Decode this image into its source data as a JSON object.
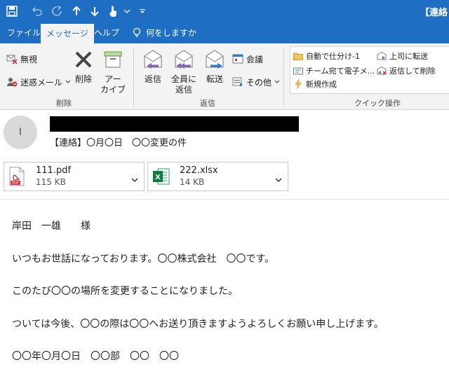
{
  "window": {
    "title": "【連絡"
  },
  "quick_access": [
    {
      "icon": "save-icon"
    },
    {
      "icon": "undo-icon"
    },
    {
      "icon": "redo-icon"
    },
    {
      "icon": "up-arrow-icon"
    },
    {
      "icon": "down-arrow-icon"
    },
    {
      "icon": "touch-mode-icon"
    },
    {
      "icon": "chevron-down-icon"
    },
    {
      "icon": "customize-icon"
    }
  ],
  "tabs": [
    {
      "label": "ファイル",
      "active": false
    },
    {
      "label": "メッセージ",
      "active": true
    },
    {
      "label": "ヘルプ",
      "active": false
    },
    {
      "label": "何をしますか",
      "active": false,
      "icon": "lightbulb-icon"
    }
  ],
  "ribbon": {
    "delete_group": {
      "label": "削除",
      "ignore": "無視",
      "junk": "迷惑メール",
      "delete": "削除",
      "archive_line1": "アー",
      "archive_line2": "カイブ"
    },
    "respond_group": {
      "label": "返信",
      "reply": "返信",
      "reply_all_line1": "全員に",
      "reply_all_line2": "返信",
      "forward": "転送",
      "meeting": "会議",
      "more": "その他"
    },
    "quick_steps_group": {
      "label": "クイック操作",
      "items": [
        {
          "label": "自動で仕分け-1",
          "icon": "folder-icon"
        },
        {
          "label": "上司に転送",
          "icon": "forward-mail-icon"
        },
        {
          "label": "チーム宛て電子メ...",
          "icon": "team-mail-icon"
        },
        {
          "label": "返信して削除",
          "icon": "reply-delete-icon"
        },
        {
          "label": "新規作成",
          "icon": "lightning-icon"
        }
      ]
    }
  },
  "message": {
    "avatar_initial": "I",
    "subject": "【連絡】〇月〇日　〇〇変更の件",
    "attachments": [
      {
        "name": "111.pdf",
        "size": "115 KB",
        "icon": "pdf-icon"
      },
      {
        "name": "222.xlsx",
        "size": "14 KB",
        "icon": "excel-icon"
      }
    ],
    "body": [
      "岸田　一雄　　様",
      "いつもお世話になっております。〇〇株式会社　〇〇です。",
      "このたび〇〇の場所を変更することになりました。",
      "ついては今後、〇〇の際は〇〇へお送り頂きますようよろしくお願い申し上げます。",
      "〇〇年〇月〇日　〇〇部　〇〇　〇〇"
    ]
  }
}
